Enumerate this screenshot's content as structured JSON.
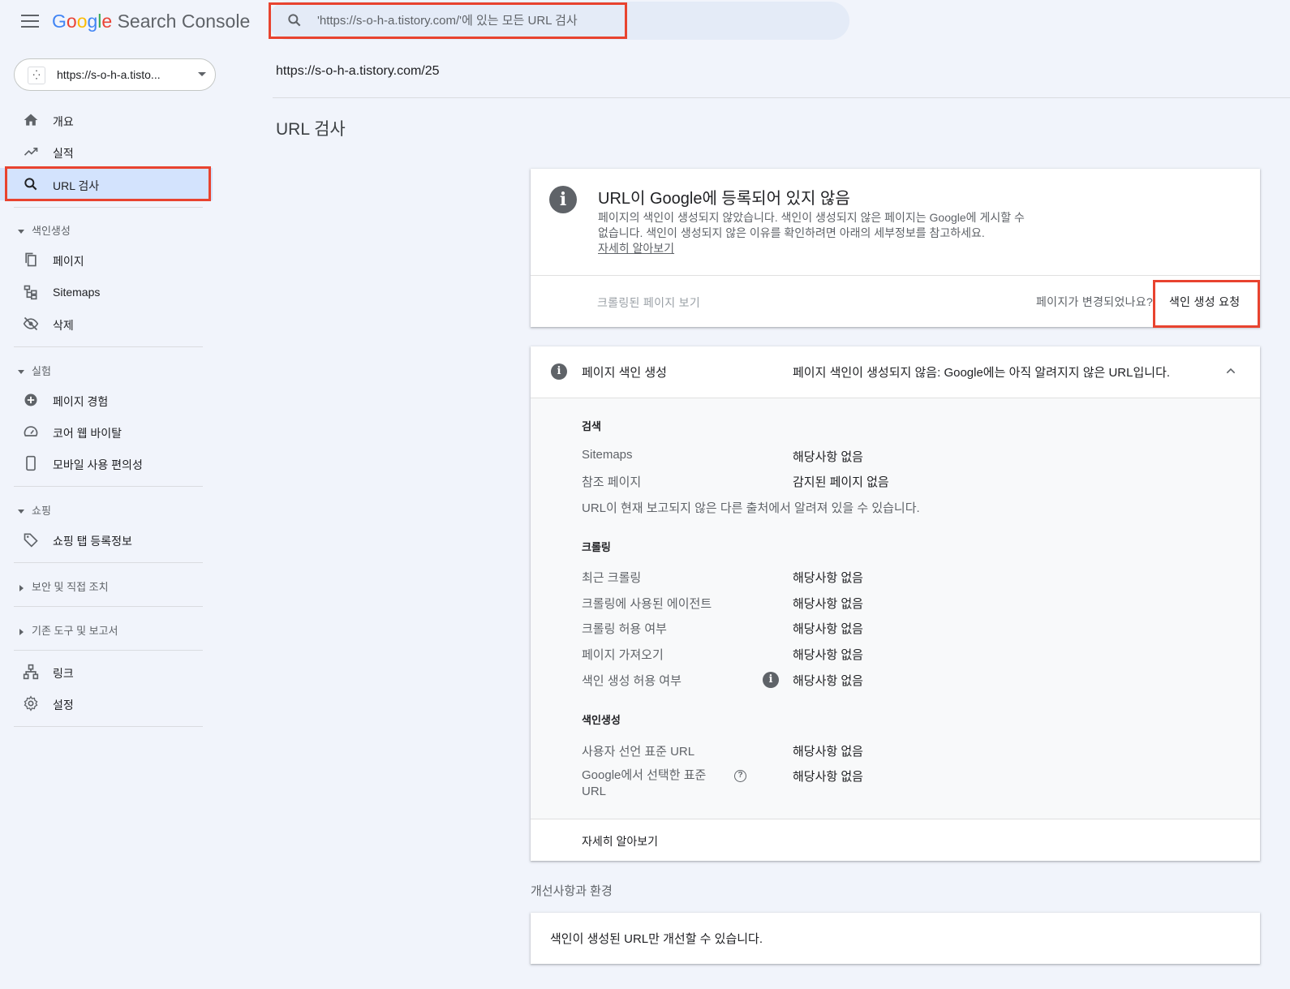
{
  "app": {
    "brand_product": "Search Console",
    "brand_google": [
      "G",
      "o",
      "o",
      "g",
      "l",
      "e"
    ],
    "brand_colors": [
      "#4285f4",
      "#ea4335",
      "#fbbc05",
      "#4285f4",
      "#34a853",
      "#ea4335"
    ]
  },
  "search": {
    "placeholder": "'https://s-o-h-a.tistory.com/'에 있는 모든 URL 검사"
  },
  "property": {
    "label": "https://s-o-h-a.tisto..."
  },
  "sidebar": {
    "overview": "개요",
    "performance": "실적",
    "url_inspection": "URL 검사",
    "section_indexing": "색인생성",
    "pages": "페이지",
    "sitemaps": "Sitemaps",
    "removals": "삭제",
    "section_experience": "실험",
    "page_experience": "페이지 경험",
    "core_web_vitals": "코어 웹 바이탈",
    "mobile_usability": "모바일 사용 편의성",
    "section_shopping": "쇼핑",
    "shopping_tab": "쇼핑 탭 등록정보",
    "section_security": "보안 및 직접 조치",
    "section_legacy": "기존 도구 및 보고서",
    "links": "링크",
    "settings": "설정"
  },
  "main": {
    "inspected_url": "https://s-o-h-a.tistory.com/25",
    "page_title": "URL 검사",
    "status": {
      "title": "URL이 Google에 등록되어 있지 않음",
      "desc_line1": "페이지의 색인이 생성되지 않았습니다. 색인이 생성되지 않은 페이지는 Google에 게시할 수",
      "desc_line2": "없습니다. 색인이 생성되지 않은 이유를 확인하려면 아래의 세부정보를 참고하세요.",
      "learn_more": "자세히 알아보기",
      "view_crawled": "크롤링된 페이지 보기",
      "changed_prompt": "페이지가 변경되었나요?",
      "request_indexing": "색인 생성 요청"
    },
    "indexing": {
      "title": "페이지 색인 생성",
      "summary": "페이지 색인이 생성되지 않음: Google에는 아직 알려지지 않은 URL입니다.",
      "discovery_title": "검색",
      "sitemaps_label": "Sitemaps",
      "sitemaps_value": "해당사항 없음",
      "referring_label": "참조 페이지",
      "referring_value": "감지된 페이지 없음",
      "discovery_note": "URL이 현재 보고되지 않은 다른 출처에서 알려져 있을 수 있습니다.",
      "crawl_title": "크롤링",
      "last_crawl_label": "최근 크롤링",
      "last_crawl_value": "해당사항 없음",
      "crawled_as_label": "크롤링에 사용된 에이전트",
      "crawled_as_value": "해당사항 없음",
      "crawl_allowed_label": "크롤링 허용 여부",
      "crawl_allowed_value": "해당사항 없음",
      "page_fetch_label": "페이지 가져오기",
      "page_fetch_value": "해당사항 없음",
      "indexing_allowed_label": "색인 생성 허용 여부",
      "indexing_allowed_value": "해당사항 없음",
      "indexing_title": "색인생성",
      "user_canonical_label": "사용자 선언 표준 URL",
      "user_canonical_value": "해당사항 없음",
      "google_canonical_label_1": "Google에서 선택한 표준",
      "google_canonical_label_2": "URL",
      "google_canonical_value": "해당사항 없음",
      "learn_more": "자세히 알아보기"
    },
    "enhancements_title": "개선사항과 환경",
    "enhancements_note": "색인이 생성된 URL만 개선할 수 있습니다."
  }
}
